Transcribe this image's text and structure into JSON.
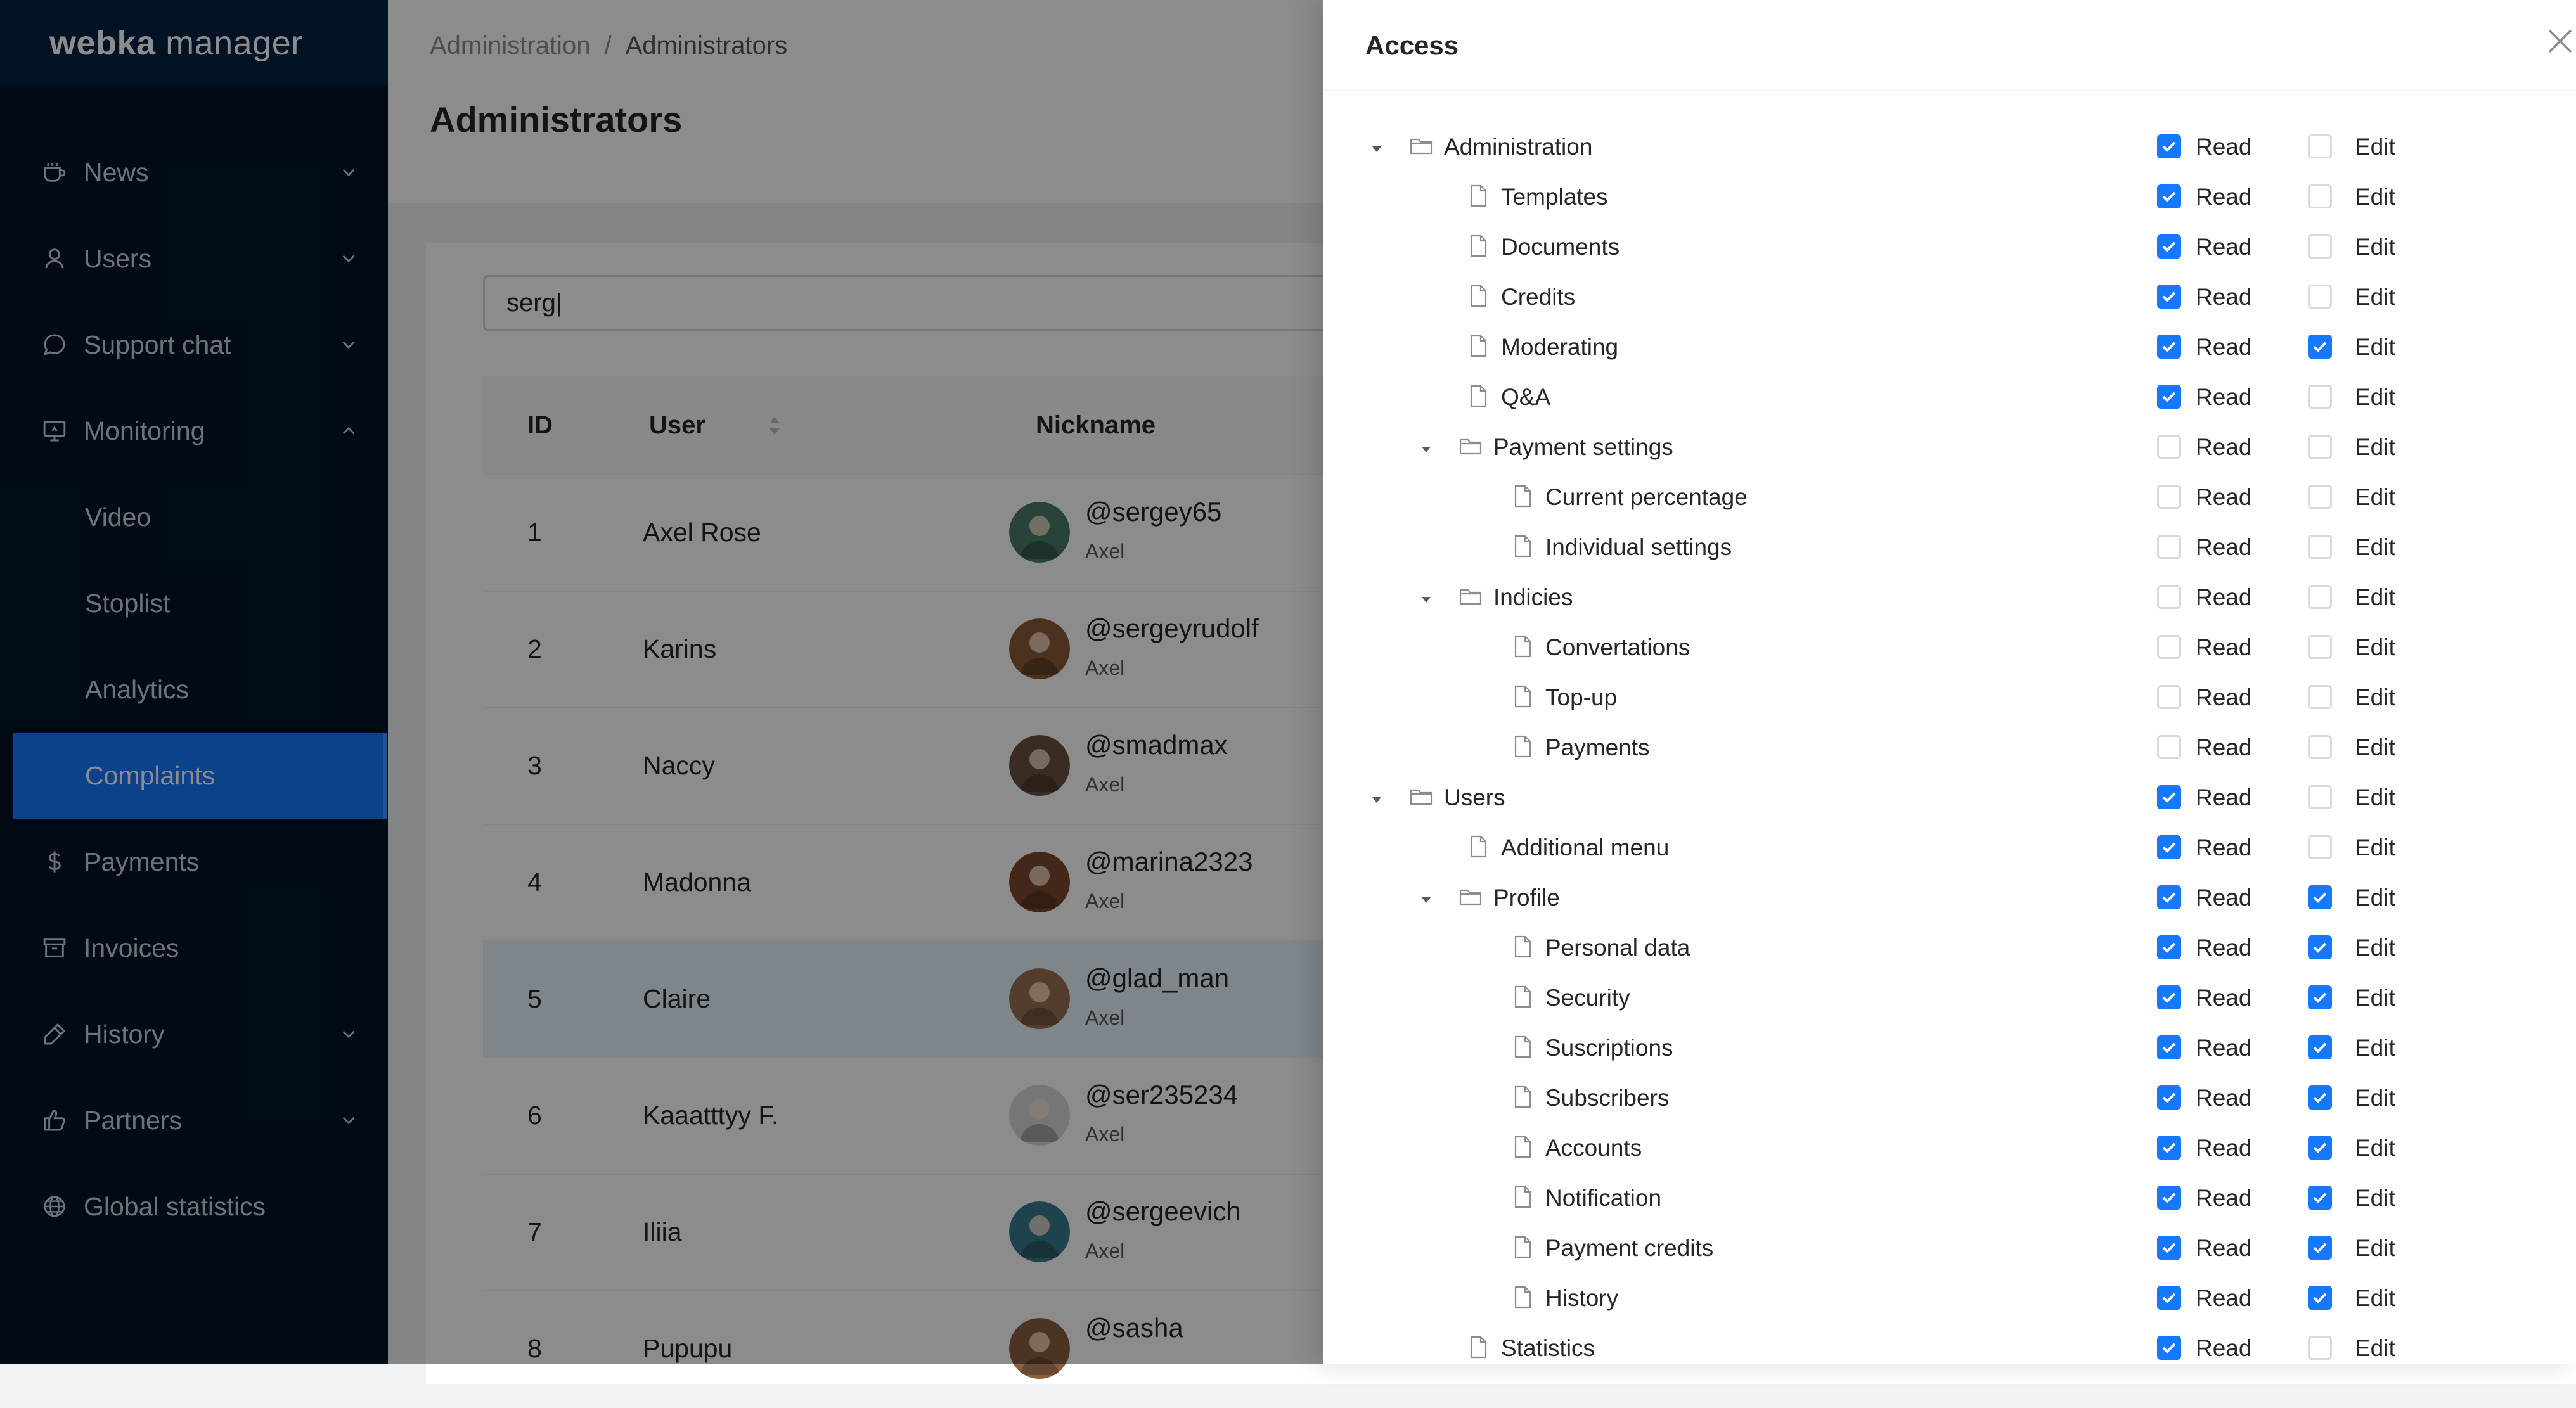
{
  "app": {
    "brand_bold": "webka",
    "brand_rest": " manager"
  },
  "sidebar": {
    "items": [
      {
        "label": "News",
        "icon": "coffee-icon",
        "chevron": "down"
      },
      {
        "label": "Users",
        "icon": "user-icon",
        "chevron": "down"
      },
      {
        "label": "Support chat",
        "icon": "chat-bubble-icon",
        "chevron": "down"
      },
      {
        "label": "Monitoring",
        "icon": "monitor-icon",
        "chevron": "up"
      },
      {
        "label": "Video",
        "sub": true
      },
      {
        "label": "Stoplist",
        "sub": true
      },
      {
        "label": "Analytics",
        "sub": true
      },
      {
        "label": "Complaints",
        "sub": true,
        "active": true
      },
      {
        "label": "Payments",
        "icon": "dollar-icon"
      },
      {
        "label": "Invoices",
        "icon": "archive-icon"
      },
      {
        "label": "History",
        "icon": "pen-icon",
        "chevron": "down"
      },
      {
        "label": "Partners",
        "icon": "thumbs-up-icon",
        "chevron": "down"
      },
      {
        "label": "Global statistics",
        "icon": "globe-icon"
      }
    ]
  },
  "header": {
    "breadcrumb": [
      "Administration",
      "Administrators"
    ],
    "breadcrumb_sep": "/",
    "title": "Administrators"
  },
  "search": {
    "value": "serg|"
  },
  "table": {
    "columns": {
      "id": "ID",
      "user": "User",
      "nickname": "Nickname"
    },
    "rows": [
      {
        "id": "1",
        "user": "Axel Rose",
        "nickname": "@sergey65",
        "sub": "Axel",
        "avatar_color": "#4a7a6a"
      },
      {
        "id": "2",
        "user": "Karins",
        "nickname": "@sergeyrudolf",
        "sub": "Axel",
        "avatar_color": "#8a5a3a"
      },
      {
        "id": "3",
        "user": "Naccy",
        "nickname": "@smadmax",
        "sub": "Axel",
        "avatar_color": "#6a5040"
      },
      {
        "id": "4",
        "user": "Madonna",
        "nickname": "@marina2323",
        "sub": "Axel",
        "avatar_color": "#7a4a30"
      },
      {
        "id": "5",
        "user": "Claire",
        "nickname": "@glad_man",
        "sub": "Axel",
        "avatar_color": "#9a7050",
        "selected": true
      },
      {
        "id": "6",
        "user": "Kaaatttyy F.",
        "nickname": "@ser235234",
        "sub": "Axel",
        "avatar_color": "#d8d8d8"
      },
      {
        "id": "7",
        "user": "Iliia",
        "nickname": "@sergeevich",
        "sub": "Axel",
        "avatar_color": "#3a7a8a"
      },
      {
        "id": "8",
        "user": "Pupupu",
        "nickname": "@sasha",
        "sub": "",
        "avatar_color": "#8a6040"
      }
    ]
  },
  "drawer": {
    "title": "Access",
    "read_label": "Read",
    "edit_label": "Edit",
    "tree": [
      {
        "label": "Administration",
        "level": 0,
        "folder": true,
        "expanded": true,
        "read": true,
        "edit": false
      },
      {
        "label": "Templates",
        "level": 1,
        "read": true,
        "edit": false
      },
      {
        "label": "Documents",
        "level": 1,
        "read": true,
        "edit": false
      },
      {
        "label": "Credits",
        "level": 1,
        "read": true,
        "edit": false
      },
      {
        "label": "Moderating",
        "level": 1,
        "read": true,
        "edit": true
      },
      {
        "label": "Q&A",
        "level": 1,
        "read": true,
        "edit": false
      },
      {
        "label": "Payment settings",
        "level": 1,
        "folder": true,
        "expanded": true,
        "read": false,
        "edit": false
      },
      {
        "label": "Current percentage",
        "level": 2,
        "read": false,
        "edit": false
      },
      {
        "label": "Individual settings",
        "level": 2,
        "read": false,
        "edit": false
      },
      {
        "label": "Indicies",
        "level": 1,
        "folder": true,
        "expanded": true,
        "read": false,
        "edit": false
      },
      {
        "label": "Convertations",
        "level": 2,
        "read": false,
        "edit": false
      },
      {
        "label": "Top-up",
        "level": 2,
        "read": false,
        "edit": false
      },
      {
        "label": "Payments",
        "level": 2,
        "read": false,
        "edit": false
      },
      {
        "label": "Users",
        "level": 0,
        "folder": true,
        "expanded": true,
        "read": true,
        "edit": false
      },
      {
        "label": "Additional menu",
        "level": 1,
        "read": true,
        "edit": false
      },
      {
        "label": "Profile",
        "level": 1,
        "folder": true,
        "expanded": true,
        "read": true,
        "edit": true
      },
      {
        "label": "Personal data",
        "level": 2,
        "read": true,
        "edit": true
      },
      {
        "label": "Security",
        "level": 2,
        "read": true,
        "edit": true
      },
      {
        "label": "Suscriptions",
        "level": 2,
        "read": true,
        "edit": true
      },
      {
        "label": "Subscribers",
        "level": 2,
        "read": true,
        "edit": true
      },
      {
        "label": "Accounts",
        "level": 2,
        "read": true,
        "edit": true
      },
      {
        "label": "Notification",
        "level": 2,
        "read": true,
        "edit": true
      },
      {
        "label": "Payment credits",
        "level": 2,
        "read": true,
        "edit": true
      },
      {
        "label": "History",
        "level": 2,
        "read": true,
        "edit": true
      },
      {
        "label": "Statistics",
        "level": 1,
        "read": true,
        "edit": false
      }
    ]
  },
  "colors": {
    "accent": "#1677ff",
    "sidebar_bg": "#001529",
    "logo_bg": "#002140"
  }
}
